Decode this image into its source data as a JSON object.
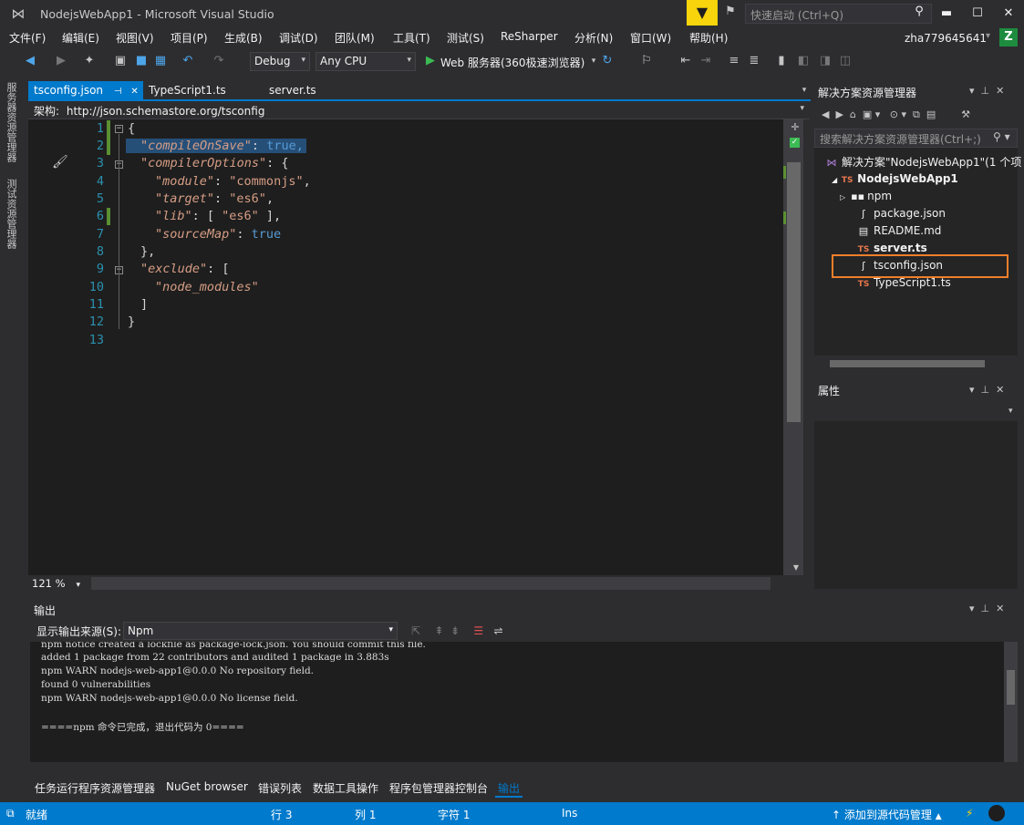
{
  "window": {
    "title": "NodejsWebApp1 - Microsoft Visual Studio",
    "quick_launch_placeholder": "快速启动 (Ctrl+Q)",
    "minimize_glyph": "▬",
    "maximize_glyph": "☐",
    "close_glyph": "✕"
  },
  "menu": {
    "items": [
      "文件(F)",
      "编辑(E)",
      "视图(V)",
      "项目(P)",
      "生成(B)",
      "调试(D)",
      "团队(M)",
      "工具(T)",
      "测试(S)",
      "ReSharper",
      "分析(N)",
      "窗口(W)",
      "帮助(H)"
    ],
    "user": "zha779645641",
    "user_initial": "Z"
  },
  "toolbar": {
    "config": "Debug",
    "platform": "Any CPU",
    "run_target": "Web 服务器(360极速浏览器)"
  },
  "left_sidebar": {
    "tabs": [
      "服务器资源管理器",
      "测试资源管理器"
    ]
  },
  "editor": {
    "tabs": [
      {
        "label": "tsconfig.json",
        "active": true
      },
      {
        "label": "TypeScript1.ts",
        "active": false
      },
      {
        "label": "server.ts",
        "active": false
      }
    ],
    "pin_glyph": "⊣",
    "close_glyph": "✕",
    "schema_label": "架构:",
    "schema_url": "http://json.schemastore.org/tsconfig",
    "zoom": "121 %",
    "line_numbers": [
      "1",
      "2",
      "3",
      "4",
      "5",
      "6",
      "7",
      "8",
      "9",
      "10",
      "11",
      "12",
      "13"
    ],
    "code": {
      "l1": "{",
      "l2_key": "\"compileOnSave\"",
      "l2_sep": ": ",
      "l2_val": "true,",
      "l3_key": "\"compilerOptions\"",
      "l3_rest": ": {",
      "l4_key": "\"module\"",
      "l4_sep": ": ",
      "l4_val": "\"commonjs\"",
      "l4_end": ",",
      "l5_key": "\"target\"",
      "l5_sep": ": ",
      "l5_val": "\"es6\"",
      "l5_end": ",",
      "l6_key": "\"lib\"",
      "l6_sep": ": [ ",
      "l6_val": "\"es6\"",
      "l6_end": " ],",
      "l7_key": "\"sourceMap\"",
      "l7_sep": ": ",
      "l7_val": "true",
      "l8": "},",
      "l9_key": "\"exclude\"",
      "l9_rest": ": [",
      "l10_val": "\"node_modules\"",
      "l11": "]",
      "l12": "}"
    }
  },
  "solution_explorer": {
    "title": "解决方案资源管理器",
    "search_placeholder": "搜索解决方案资源管理器(Ctrl+;)",
    "solution": "解决方案\"NodejsWebApp1\"(1 个项",
    "project": "NodejsWebApp1",
    "items": {
      "npm": "npm",
      "package": "package.json",
      "readme": "README.md",
      "server": "server.ts",
      "tsconfig": "tsconfig.json",
      "typescript1": "TypeScript1.ts"
    },
    "ts_badge": "TS"
  },
  "properties": {
    "title": "属性"
  },
  "output": {
    "title": "输出",
    "source_label": "显示输出来源(S):",
    "source_value": "Npm",
    "lines": [
      "npm notice created a lockfile as package-lock.json. You should commit this file.",
      "added 1 package from 22 contributors and audited 1 package in 3.883s",
      "npm WARN nodejs-web-app1@0.0.0 No repository field.",
      "found 0 vulnerabilities",
      "npm WARN nodejs-web-app1@0.0.0 No license field.",
      "",
      "====npm 命令已完成，退出代码为 0===="
    ]
  },
  "bottom_tabs": [
    "任务运行程序资源管理器",
    "NuGet browser",
    "错误列表",
    "数据工具操作",
    "程序包管理器控制台",
    "输出"
  ],
  "status": {
    "ready": "就绪",
    "row": "行 3",
    "col": "列 1",
    "char": "字符 1",
    "mode": "Ins",
    "source_control": "添加到源代码管理"
  },
  "colors": {
    "accent": "#007acc",
    "highlight_box": "#ef7f2b",
    "filter_button": "#f7d40b"
  }
}
